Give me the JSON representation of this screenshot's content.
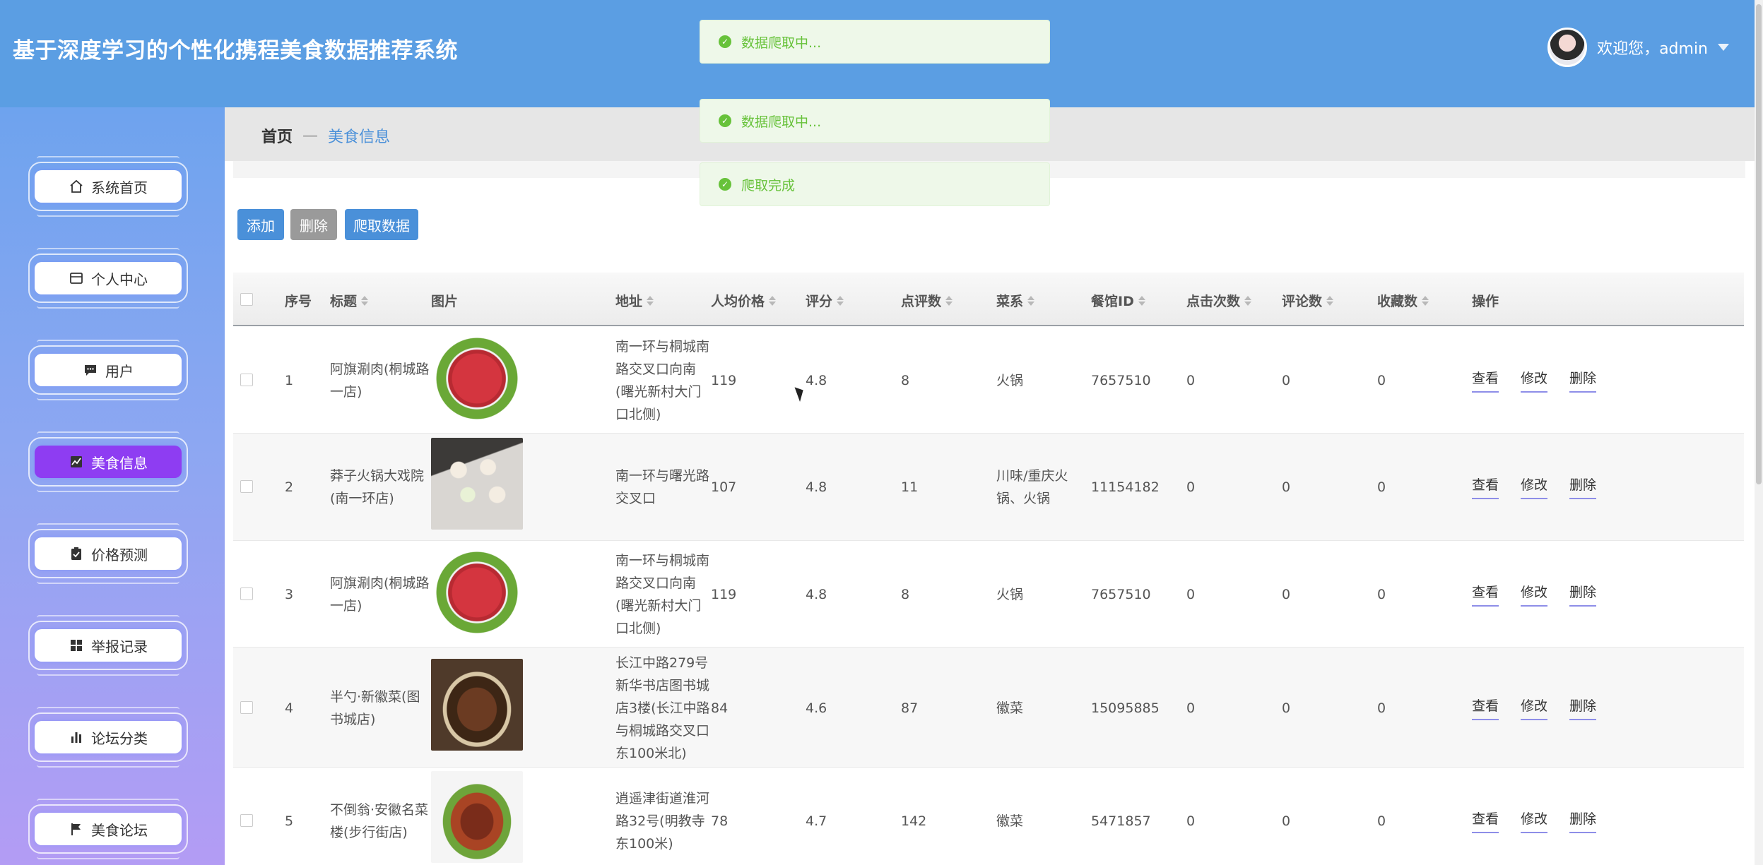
{
  "header": {
    "title": "基于深度学习的个性化携程美食数据推荐系统",
    "welcome": "欢迎您，admin"
  },
  "sidebar": {
    "items": [
      {
        "label": "系统首页",
        "icon": "home-icon"
      },
      {
        "label": "个人中心",
        "icon": "id-card-icon"
      },
      {
        "label": "用户",
        "icon": "chat-icon"
      },
      {
        "label": "美食信息",
        "icon": "chart-icon",
        "active": true
      },
      {
        "label": "价格预测",
        "icon": "clipboard-icon"
      },
      {
        "label": "举报记录",
        "icon": "grid-icon"
      },
      {
        "label": "论坛分类",
        "icon": "bar-chart-icon"
      },
      {
        "label": "美食论坛",
        "icon": "flag-icon"
      }
    ]
  },
  "breadcrumb": {
    "home": "首页",
    "separator": "—",
    "current": "美食信息"
  },
  "toasts": [
    "数据爬取中...",
    "数据爬取中...",
    "爬取完成"
  ],
  "toolbar": {
    "add": "添加",
    "delete": "删除",
    "crawl": "爬取数据"
  },
  "table": {
    "columns": [
      "序号",
      "标题",
      "图片",
      "地址",
      "人均价格",
      "评分",
      "点评数",
      "菜系",
      "餐馆ID",
      "点击次数",
      "评论数",
      "收藏数",
      "操作"
    ],
    "actions": [
      "查看",
      "修改",
      "删除"
    ],
    "rows": [
      {
        "no": "1",
        "title": [
          "阿旗涮肉(桐城路",
          "一店)"
        ],
        "image": "meat",
        "address": [
          "南一环与桐城南",
          "路交叉口向南",
          "(曙光新村大门",
          "口北侧)"
        ],
        "price": "119",
        "rating": "4.8",
        "reviews": "8",
        "cuisine": [
          "火锅"
        ],
        "rid": "7657510",
        "clicks": "0",
        "comments": "0",
        "favorites": "0"
      },
      {
        "no": "2",
        "title": [
          "莽子火锅大戏院",
          "(南一环店)"
        ],
        "image": "buns",
        "address": [
          "南一环与曙光路",
          "交叉口"
        ],
        "price": "107",
        "rating": "4.8",
        "reviews": "11",
        "cuisine": [
          "川味/重庆火",
          "锅、火锅"
        ],
        "rid": "11154182",
        "clicks": "0",
        "comments": "0",
        "favorites": "0"
      },
      {
        "no": "3",
        "title": [
          "阿旗涮肉(桐城路",
          "一店)"
        ],
        "image": "meat",
        "address": [
          "南一环与桐城南",
          "路交叉口向南",
          "(曙光新村大门",
          "口北侧)"
        ],
        "price": "119",
        "rating": "4.8",
        "reviews": "8",
        "cuisine": [
          "火锅"
        ],
        "rid": "7657510",
        "clicks": "0",
        "comments": "0",
        "favorites": "0"
      },
      {
        "no": "4",
        "title": [
          "半勺·新徽菜(图",
          "书城店)"
        ],
        "image": "tofu",
        "address": [
          "长江中路279号",
          "新华书店图书城",
          "店3楼(长江中路",
          "与桐城路交叉口",
          "东100米北)"
        ],
        "price": "84",
        "rating": "4.6",
        "reviews": "87",
        "cuisine": [
          "徽菜"
        ],
        "rid": "15095885",
        "clicks": "0",
        "comments": "0",
        "favorites": "0"
      },
      {
        "no": "5",
        "title": [
          "不倒翁·安徽名菜",
          "楼(步行街店)"
        ],
        "image": "dish",
        "address": [
          "逍遥津街道淮河",
          "路32号(明教寺",
          "东100米)"
        ],
        "price": "78",
        "rating": "4.7",
        "reviews": "142",
        "cuisine": [
          "徽菜"
        ],
        "rid": "5471857",
        "clicks": "0",
        "comments": "0",
        "favorites": "0"
      }
    ]
  }
}
